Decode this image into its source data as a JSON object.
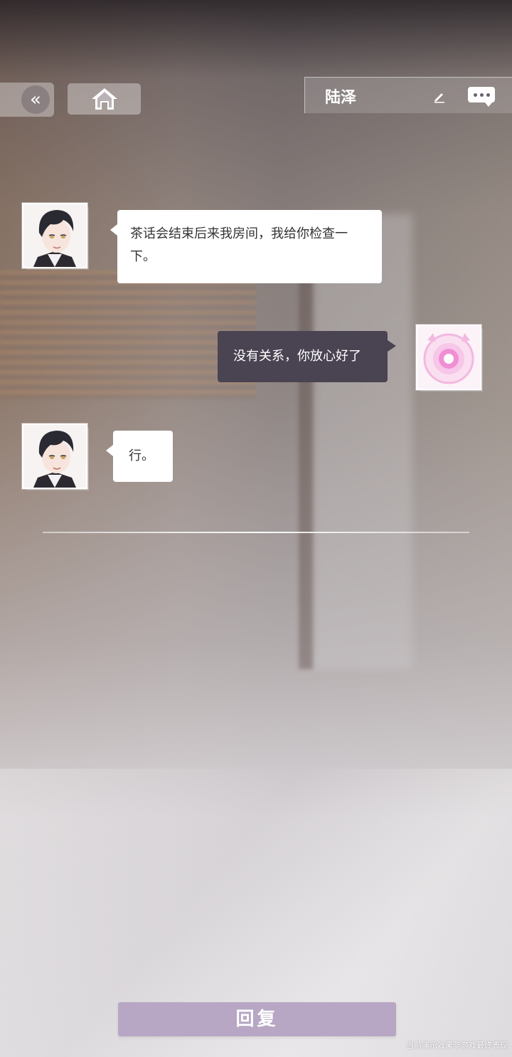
{
  "header": {
    "back_icon": "double-chevron-left-icon",
    "home_icon": "home-icon",
    "contact_name": "陆泽",
    "edit_icon": "pencil-icon",
    "more_icon": "chat-bubble-dots-icon"
  },
  "messages": [
    {
      "sender": "陆泽",
      "direction": "incoming",
      "text": "茶话会结束后来我房间，我给你检查一下。"
    },
    {
      "sender": "self",
      "direction": "outgoing",
      "text": "没有关系，你放心好了"
    },
    {
      "sender": "陆泽",
      "direction": "incoming",
      "text": "行。"
    }
  ],
  "footer": {
    "reply_label": "回复",
    "disclaimer": "当前演示效果非游戏最终表现"
  },
  "colors": {
    "outgoing_bubble": "#4a4352",
    "incoming_bubble": "#ffffff",
    "reply_button": "#b7a7c4"
  }
}
